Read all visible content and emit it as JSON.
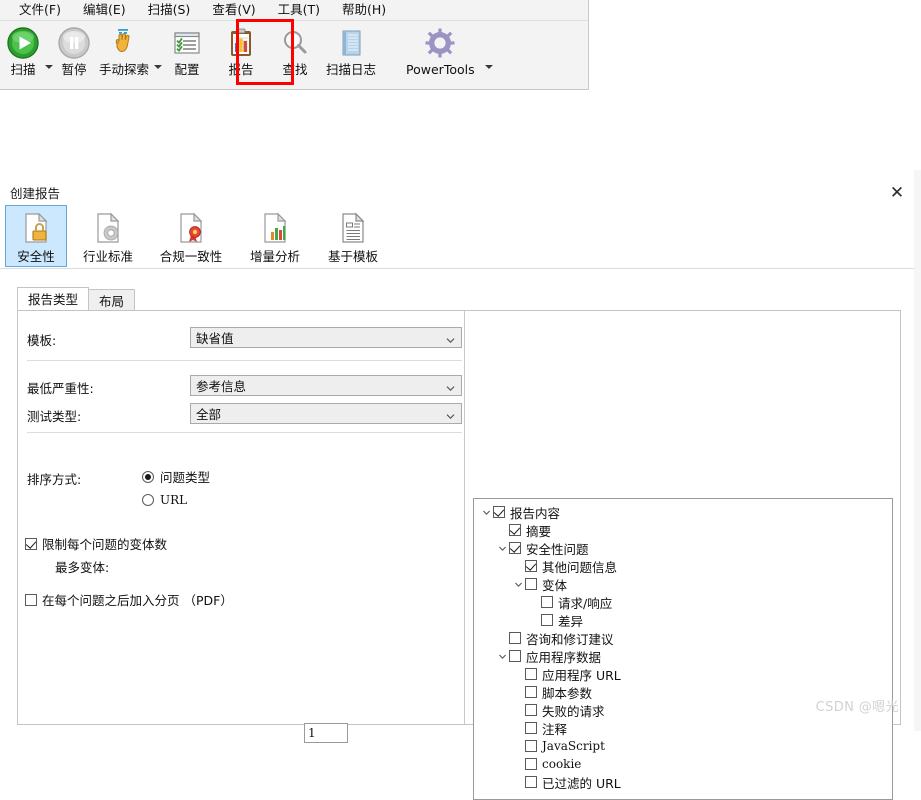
{
  "app": {
    "menubar": [
      {
        "label": "文件(F)",
        "name": "menu-file"
      },
      {
        "label": "编辑(E)",
        "name": "menu-edit"
      },
      {
        "label": "扫描(S)",
        "name": "menu-scan"
      },
      {
        "label": "查看(V)",
        "name": "menu-view"
      },
      {
        "label": "工具(T)",
        "name": "menu-tools"
      },
      {
        "label": "帮助(H)",
        "name": "menu-help"
      }
    ],
    "toolbar": [
      {
        "label": "扫描",
        "icon": "play-icon",
        "caret": true
      },
      {
        "label": "暂停",
        "icon": "pause-icon",
        "caret": false
      },
      {
        "label": "手动探索",
        "icon": "hand-icon",
        "caret": true
      },
      {
        "label": "配置",
        "icon": "config-list-icon",
        "caret": false
      },
      {
        "label": "报告",
        "icon": "report-clipboard-icon",
        "caret": false
      },
      {
        "label": "查找",
        "icon": "search-magnifier-icon",
        "caret": false
      },
      {
        "label": "扫描日志",
        "icon": "log-book-icon",
        "caret": false
      },
      {
        "label": "PowerTools",
        "icon": "gear-icon",
        "caret": true
      }
    ],
    "highlight_color": "#ff0000"
  },
  "dialog": {
    "title": "创建报告",
    "close_label": "✕",
    "report_types": [
      {
        "label": "安全性",
        "icon": "document-lock-icon",
        "selected": true
      },
      {
        "label": "行业标准",
        "icon": "document-gear-icon",
        "selected": false
      },
      {
        "label": "合规一致性",
        "icon": "document-seal-icon",
        "selected": false
      },
      {
        "label": "增量分析",
        "icon": "document-chart-icon",
        "selected": false
      },
      {
        "label": "基于模板",
        "icon": "document-template-icon",
        "selected": false
      }
    ],
    "tabs": [
      {
        "label": "报告类型",
        "active": true
      },
      {
        "label": "布局",
        "active": false
      }
    ],
    "form": {
      "template_label": "模板:",
      "template_value": "缺省值",
      "severity_label": "最低严重性:",
      "severity_value": "参考信息",
      "test_type_label": "测试类型:",
      "test_type_value": "全部",
      "sort_label": "排序方式:",
      "sort_options": [
        {
          "label": "问题类型",
          "selected": true
        },
        {
          "label": "URL",
          "selected": false
        }
      ],
      "limit_variants_label": "限制每个问题的变体数",
      "limit_variants_checked": true,
      "max_variants_label": "最多变体:",
      "max_variants_value": "1",
      "page_break_label": "在每个问题之后加入分页 （PDF）",
      "page_break_checked": false
    },
    "tree": [
      {
        "label": "报告内容",
        "indent": 0,
        "arrow": "down",
        "checked": true,
        "serif": false
      },
      {
        "label": "摘要",
        "indent": 1,
        "arrow": "none",
        "checked": true,
        "serif": false
      },
      {
        "label": "安全性问题",
        "indent": 1,
        "arrow": "down",
        "checked": true,
        "serif": false
      },
      {
        "label": "其他问题信息",
        "indent": 2,
        "arrow": "none",
        "checked": true,
        "serif": false
      },
      {
        "label": "变体",
        "indent": 2,
        "arrow": "down",
        "checked": false,
        "serif": false
      },
      {
        "label": "请求/响应",
        "indent": 3,
        "arrow": "none",
        "checked": false,
        "serif": false
      },
      {
        "label": "差异",
        "indent": 3,
        "arrow": "none",
        "checked": false,
        "serif": false
      },
      {
        "label": "咨询和修订建议",
        "indent": 1,
        "arrow": "none",
        "checked": false,
        "serif": false
      },
      {
        "label": "应用程序数据",
        "indent": 1,
        "arrow": "down",
        "checked": false,
        "serif": false
      },
      {
        "label": "应用程序 URL",
        "indent": 2,
        "arrow": "none",
        "checked": false,
        "serif": false
      },
      {
        "label": "脚本参数",
        "indent": 2,
        "arrow": "none",
        "checked": false,
        "serif": false
      },
      {
        "label": "失败的请求",
        "indent": 2,
        "arrow": "none",
        "checked": false,
        "serif": false
      },
      {
        "label": "注释",
        "indent": 2,
        "arrow": "none",
        "checked": false,
        "serif": false
      },
      {
        "label": "JavaScript",
        "indent": 2,
        "arrow": "none",
        "checked": false,
        "serif": true
      },
      {
        "label": "cookie",
        "indent": 2,
        "arrow": "none",
        "checked": false,
        "serif": true
      },
      {
        "label": "已过滤的 URL",
        "indent": 2,
        "arrow": "none",
        "checked": false,
        "serif": false
      }
    ]
  },
  "watermark": "CSDN @嗯光"
}
